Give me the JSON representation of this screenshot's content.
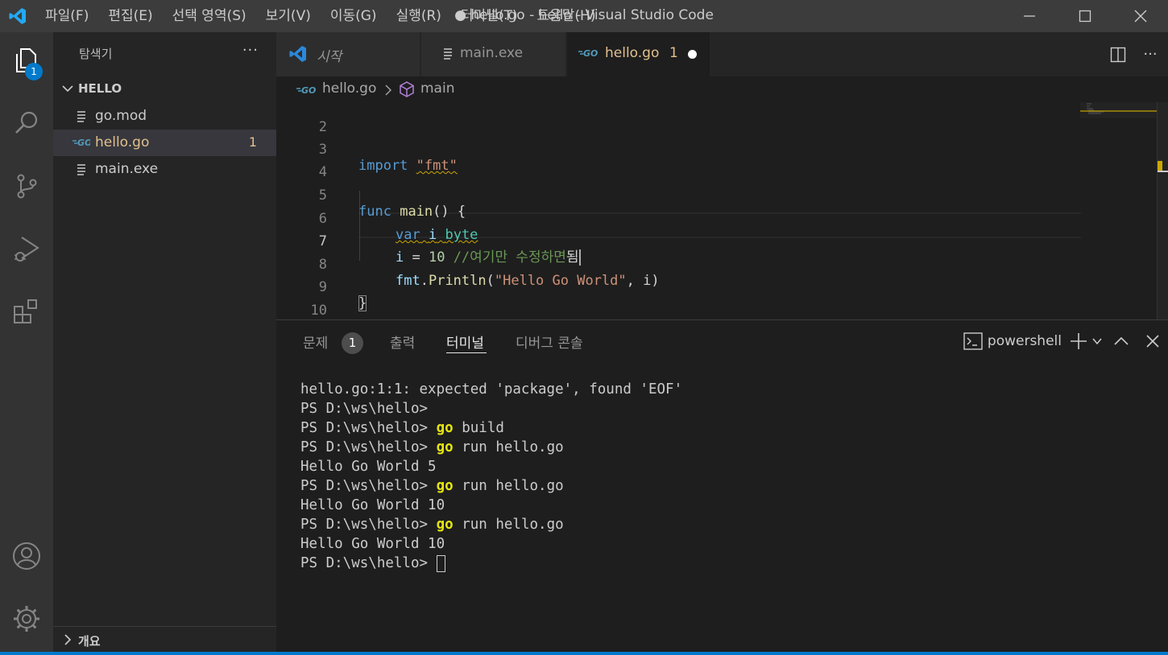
{
  "titlebar": {
    "menu": [
      "파일(F)",
      "편집(E)",
      "선택 영역(S)",
      "보기(V)",
      "이동(G)",
      "실행(R)",
      "터미널(T)",
      "도움말(H)"
    ],
    "title": "● hello.go - hello - Visual Studio Code"
  },
  "activitybar": {
    "items": [
      "explorer-icon",
      "search-icon",
      "source-control-icon",
      "run-debug-icon",
      "extensions-icon"
    ],
    "explorer_badge": "1",
    "bottom": [
      "account-icon",
      "manage-gear-icon"
    ]
  },
  "sidebar": {
    "title": "탐색기",
    "more": "···",
    "folder": "HELLO",
    "files": [
      {
        "name": "go.mod",
        "icon": "lines-icon"
      },
      {
        "name": "hello.go",
        "icon": "go-icon",
        "problems": "1"
      },
      {
        "name": "main.exe",
        "icon": "lines-icon"
      }
    ],
    "outline": "개요"
  },
  "tabs": [
    {
      "label": "시작",
      "icon": "vscode-logo-icon"
    },
    {
      "label": "main.exe",
      "icon": "lines-icon"
    },
    {
      "label": "hello.go",
      "icon": "go-icon",
      "problems": "1",
      "dirty": true
    }
  ],
  "breadcrumb": {
    "file": "hello.go",
    "symbol": "main"
  },
  "editor": {
    "line_numbers": [
      "2",
      "3",
      "4",
      "5",
      "6",
      "7",
      "8",
      "9",
      "10"
    ],
    "code": {
      "l3_kw": "import",
      "l3_str": "\"fmt\"",
      "l5_kw": "func",
      "l5_fn": "main",
      "l5_rest": "() {",
      "l6_kw": "var",
      "l6_id": "i",
      "l6_ty": "byte",
      "l7_id": "i",
      "l7_op": " = ",
      "l7_num": "10",
      "l7_cm": " //여기만 수정하면",
      "l7_typed": "됨",
      "l8_pkg": "fmt",
      "l8_fn": "Println",
      "l8_str": "\"Hello Go World\"",
      "l8_rest": ", i)",
      "l9": "}"
    }
  },
  "panel": {
    "tabs": [
      "문제",
      "출력",
      "터미널",
      "디버그 콘솔"
    ],
    "problems_count": "1",
    "shell": "powershell",
    "terminal": [
      {
        "text": "hello.go:1:1: expected 'package', found 'EOF'"
      },
      {
        "prompt": "PS D:\\ws\\hello>",
        "cmd": "",
        "args": ""
      },
      {
        "prompt": "PS D:\\ws\\hello>",
        "cmd": "go",
        "args": " build"
      },
      {
        "prompt": "PS D:\\ws\\hello>",
        "cmd": "go",
        "args": " run hello.go"
      },
      {
        "text": "Hello Go World 5"
      },
      {
        "prompt": "PS D:\\ws\\hello>",
        "cmd": "go",
        "args": " run hello.go"
      },
      {
        "text": "Hello Go World 10"
      },
      {
        "prompt": "PS D:\\ws\\hello>",
        "cmd": "go",
        "args": " run hello.go"
      },
      {
        "text": "Hello Go World 10"
      },
      {
        "prompt": "PS D:\\ws\\hello>",
        "cmd": "",
        "args": " ",
        "cursor": true
      }
    ]
  },
  "colors": {
    "accent": "#007acc",
    "modified_file": "#e2c08d",
    "go_command": "#e5e510"
  }
}
